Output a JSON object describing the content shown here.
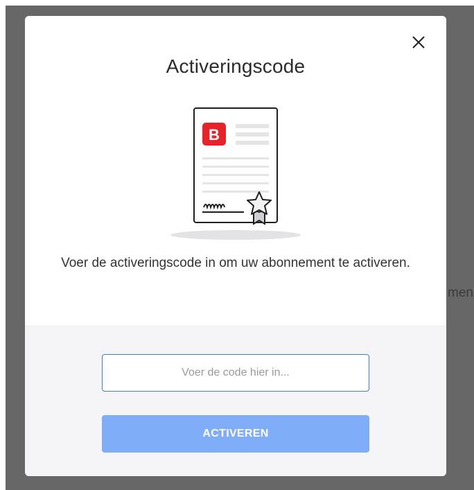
{
  "background": {
    "peek_text": "men"
  },
  "modal": {
    "title": "Activeringscode",
    "description": "Voer de activeringscode in om uw abonnement te activeren.",
    "close_icon": "close-icon",
    "illustration": {
      "icon": "certificate-icon",
      "logo_letter": "B",
      "signature": "mmm",
      "badge_icon": "star-badge-icon"
    },
    "input": {
      "value": "",
      "placeholder": "Voer de code hier in..."
    },
    "button": {
      "label": "ACTIVEREN"
    }
  },
  "colors": {
    "backdrop": "#676767",
    "brand_red": "#e8222b",
    "input_border": "#3d7be0",
    "button_bg": "#80adf7",
    "footer_bg": "#f5f5f7"
  }
}
